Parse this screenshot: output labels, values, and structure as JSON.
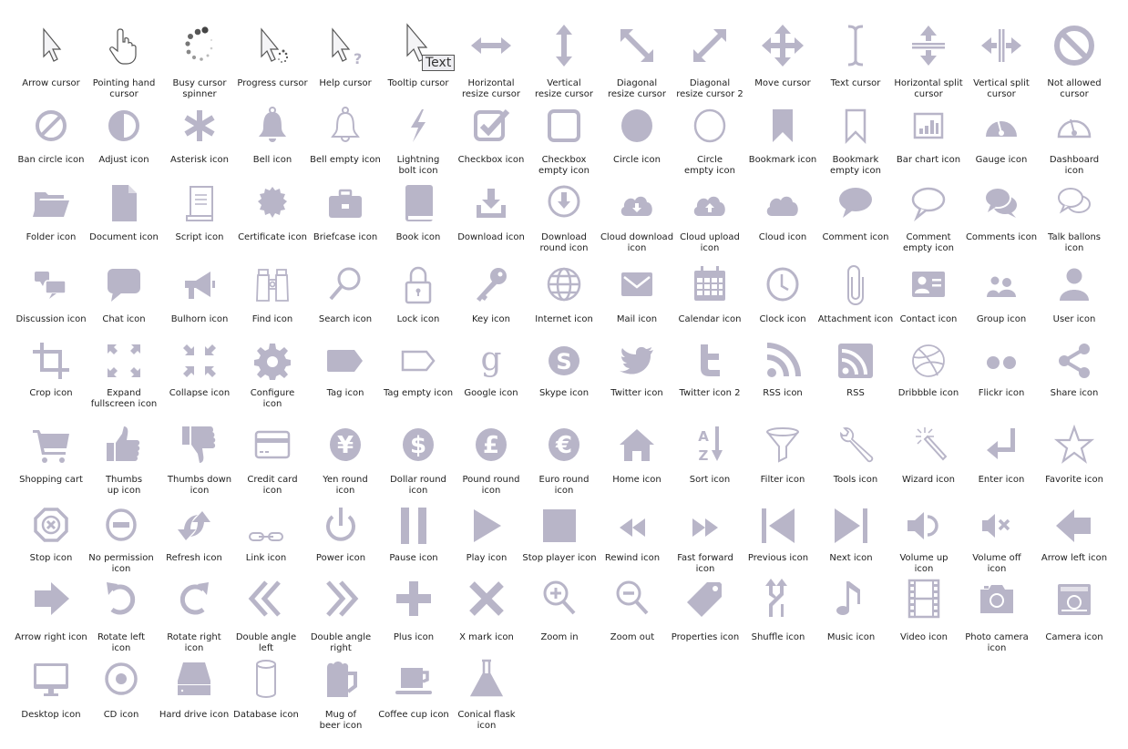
{
  "colors": {
    "icon": "#B8B5C8",
    "dark": "#55535f",
    "label": "#222222"
  },
  "rows": [
    [
      {
        "label": "Arrow cursor",
        "icon": "arrow-cursor"
      },
      {
        "label": "Pointing hand\ncursor",
        "icon": "pointing-hand-cursor"
      },
      {
        "label": "Busy cursor\nspinner",
        "icon": "busy-spinner"
      },
      {
        "label": "Progress cursor",
        "icon": "progress-cursor"
      },
      {
        "label": "Help cursor",
        "icon": "help-cursor"
      },
      {
        "label": "Tooltip cursor",
        "icon": "tooltip-cursor",
        "tooltip_text": "Text"
      },
      {
        "label": "Horizontal\nresize cursor",
        "icon": "horizontal-resize"
      },
      {
        "label": "Vertical\nresize cursor",
        "icon": "vertical-resize"
      },
      {
        "label": "Diagonal\nresize cursor",
        "icon": "diagonal-resize"
      },
      {
        "label": "Diagonal\nresize cursor 2",
        "icon": "diagonal-resize-2"
      },
      {
        "label": "Move cursor",
        "icon": "move"
      },
      {
        "label": "Text cursor",
        "icon": "text-cursor"
      },
      {
        "label": "Horizontal split\ncursor",
        "icon": "horizontal-split"
      },
      {
        "label": "Vertical split\ncursor",
        "icon": "vertical-split"
      },
      {
        "label": "Not allowed\ncursor",
        "icon": "not-allowed"
      }
    ],
    [
      {
        "label": "Ban circle icon",
        "icon": "ban-circle"
      },
      {
        "label": "Adjust icon",
        "icon": "adjust"
      },
      {
        "label": "Asterisk icon",
        "icon": "asterisk"
      },
      {
        "label": "Bell icon",
        "icon": "bell"
      },
      {
        "label": "Bell empty icon",
        "icon": "bell-empty"
      },
      {
        "label": "Lightning\nbolt icon",
        "icon": "lightning"
      },
      {
        "label": "Checkbox icon",
        "icon": "checkbox"
      },
      {
        "label": "Checkbox\nempty icon",
        "icon": "checkbox-empty"
      },
      {
        "label": "Circle icon",
        "icon": "circle"
      },
      {
        "label": "Circle\nempty icon",
        "icon": "circle-empty"
      },
      {
        "label": "Bookmark icon",
        "icon": "bookmark"
      },
      {
        "label": "Bookmark\nempty icon",
        "icon": "bookmark-empty"
      },
      {
        "label": "Bar chart icon",
        "icon": "bar-chart"
      },
      {
        "label": "Gauge icon",
        "icon": "gauge"
      },
      {
        "label": "Dashboard\nicon",
        "icon": "dashboard"
      }
    ],
    [
      {
        "label": "Folder icon",
        "icon": "folder"
      },
      {
        "label": "Document icon",
        "icon": "document"
      },
      {
        "label": "Script icon",
        "icon": "script"
      },
      {
        "label": "Certificate icon",
        "icon": "certificate"
      },
      {
        "label": "Briefcase icon",
        "icon": "briefcase"
      },
      {
        "label": "Book icon",
        "icon": "book"
      },
      {
        "label": "Download icon",
        "icon": "download"
      },
      {
        "label": "Download\nround icon",
        "icon": "download-round"
      },
      {
        "label": "Cloud download\nicon",
        "icon": "cloud-download"
      },
      {
        "label": "Cloud upload\nicon",
        "icon": "cloud-upload"
      },
      {
        "label": "Cloud icon",
        "icon": "cloud"
      },
      {
        "label": "Comment icon",
        "icon": "comment"
      },
      {
        "label": "Comment\nempty icon",
        "icon": "comment-empty"
      },
      {
        "label": "Comments icon",
        "icon": "comments"
      },
      {
        "label": "Talk ballons\nicon",
        "icon": "talk-balloons"
      }
    ],
    [
      {
        "label": "Discussion icon",
        "icon": "discussion"
      },
      {
        "label": "Chat icon",
        "icon": "chat"
      },
      {
        "label": "Bulhorn icon",
        "icon": "bullhorn"
      },
      {
        "label": "Find icon",
        "icon": "binoculars"
      },
      {
        "label": "Search icon",
        "icon": "search"
      },
      {
        "label": "Lock icon",
        "icon": "lock"
      },
      {
        "label": "Key icon",
        "icon": "key"
      },
      {
        "label": "Internet icon",
        "icon": "globe"
      },
      {
        "label": "Mail icon",
        "icon": "mail"
      },
      {
        "label": "Calendar icon",
        "icon": "calendar"
      },
      {
        "label": "Clock icon",
        "icon": "clock"
      },
      {
        "label": "Attachment icon",
        "icon": "paperclip"
      },
      {
        "label": "Contact icon",
        "icon": "contact-card"
      },
      {
        "label": "Group icon",
        "icon": "group"
      },
      {
        "label": "User icon",
        "icon": "user"
      }
    ],
    [
      {
        "label": "Crop icon",
        "icon": "crop"
      },
      {
        "label": "Expand\nfullscreen icon",
        "icon": "expand"
      },
      {
        "label": "Collapse icon",
        "icon": "collapse"
      },
      {
        "label": "Configure\nicon",
        "icon": "gear"
      },
      {
        "label": "Tag icon",
        "icon": "tag"
      },
      {
        "label": "Tag empty icon",
        "icon": "tag-empty"
      },
      {
        "label": "Google icon",
        "icon": "google"
      },
      {
        "label": "Skype icon",
        "icon": "skype"
      },
      {
        "label": "Twitter icon",
        "icon": "twitter-bird"
      },
      {
        "label": "Twitter icon 2",
        "icon": "twitter-t"
      },
      {
        "label": "RSS icon",
        "icon": "rss"
      },
      {
        "label": "RSS",
        "icon": "rss-square"
      },
      {
        "label": "Dribbble icon",
        "icon": "dribbble"
      },
      {
        "label": "Flickr icon",
        "icon": "flickr"
      },
      {
        "label": "Share icon",
        "icon": "share"
      }
    ],
    [
      {
        "label": "Shopping cart",
        "icon": "shopping-cart"
      },
      {
        "label": "Thumbs\nup icon",
        "icon": "thumbs-up"
      },
      {
        "label": "Thumbs down\nicon",
        "icon": "thumbs-down"
      },
      {
        "label": "Credit card\nicon",
        "icon": "credit-card"
      },
      {
        "label": "Yen round\nicon",
        "icon": "yen",
        "glyph": "¥"
      },
      {
        "label": "Dollar round\nicon",
        "icon": "dollar",
        "glyph": "$"
      },
      {
        "label": "Pound round\nicon",
        "icon": "pound",
        "glyph": "£"
      },
      {
        "label": "Euro round\nicon",
        "icon": "euro",
        "glyph": "€"
      },
      {
        "label": "Home icon",
        "icon": "home"
      },
      {
        "label": "Sort icon",
        "icon": "sort"
      },
      {
        "label": "Filter icon",
        "icon": "filter"
      },
      {
        "label": "Tools icon",
        "icon": "wrench"
      },
      {
        "label": "Wizard icon",
        "icon": "magic-wand"
      },
      {
        "label": "Enter icon",
        "icon": "enter"
      },
      {
        "label": "Favorite icon",
        "icon": "star"
      }
    ],
    [
      {
        "label": "Stop icon",
        "icon": "stop-octagon"
      },
      {
        "label": "No permission\nicon",
        "icon": "minus-circle"
      },
      {
        "label": "Refresh icon",
        "icon": "refresh"
      },
      {
        "label": "Link icon",
        "icon": "link"
      },
      {
        "label": "Power icon",
        "icon": "power"
      },
      {
        "label": "Pause icon",
        "icon": "pause"
      },
      {
        "label": "Play icon",
        "icon": "play"
      },
      {
        "label": "Stop player icon",
        "icon": "stop-square"
      },
      {
        "label": "Rewind icon",
        "icon": "rewind"
      },
      {
        "label": "Fast forward\nicon",
        "icon": "fast-forward"
      },
      {
        "label": "Previous icon",
        "icon": "previous"
      },
      {
        "label": "Next icon",
        "icon": "next"
      },
      {
        "label": "Volume up\nicon",
        "icon": "volume-up"
      },
      {
        "label": "Volume off\nicon",
        "icon": "volume-off"
      },
      {
        "label": "Arrow left icon",
        "icon": "arrow-left"
      }
    ],
    [
      {
        "label": "Arrow right icon",
        "icon": "arrow-right"
      },
      {
        "label": "Rotate left\nicon",
        "icon": "rotate-left"
      },
      {
        "label": "Rotate right\nicon",
        "icon": "rotate-right"
      },
      {
        "label": "Double angle\nleft",
        "icon": "double-angle-left"
      },
      {
        "label": "Double angle\nright",
        "icon": "double-angle-right"
      },
      {
        "label": "Plus icon",
        "icon": "plus"
      },
      {
        "label": "X mark icon",
        "icon": "x-mark"
      },
      {
        "label": "Zoom in",
        "icon": "zoom-in"
      },
      {
        "label": "Zoom out",
        "icon": "zoom-out"
      },
      {
        "label": "Properties icon",
        "icon": "price-tag"
      },
      {
        "label": "Shuffle icon",
        "icon": "shuffle"
      },
      {
        "label": "Music icon",
        "icon": "music"
      },
      {
        "label": "Video icon",
        "icon": "film"
      },
      {
        "label": "Photo camera\nicon",
        "icon": "photo-camera"
      },
      {
        "label": "Camera icon",
        "icon": "camera"
      }
    ],
    [
      {
        "label": "Desktop icon",
        "icon": "desktop"
      },
      {
        "label": "CD icon",
        "icon": "cd"
      },
      {
        "label": "Hard drive icon",
        "icon": "hard-drive"
      },
      {
        "label": "Database icon",
        "icon": "database"
      },
      {
        "label": "Mug of\nbeer icon",
        "icon": "beer-mug"
      },
      {
        "label": "Coffee cup icon",
        "icon": "coffee-cup"
      },
      {
        "label": "Conical flask\nicon",
        "icon": "flask"
      }
    ]
  ]
}
